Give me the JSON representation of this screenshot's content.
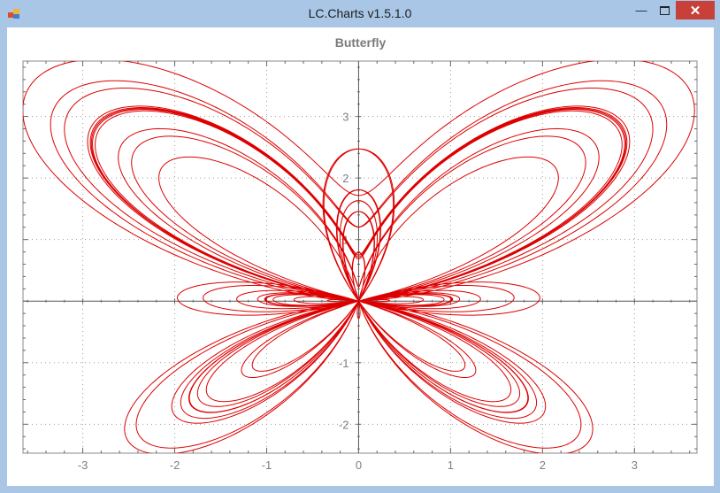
{
  "window": {
    "title": "LC.Charts v1.5.1.0",
    "min_icon": "minimize-icon",
    "max_icon": "maximize-icon",
    "close_icon": "close-icon"
  },
  "chart_data": {
    "type": "line",
    "title": "Butterfly",
    "xlabel": "",
    "ylabel": "",
    "xlim": [
      -3.65,
      3.68
    ],
    "ylim": [
      -2.47,
      3.9
    ],
    "x_ticks": [
      -3,
      -2,
      -1,
      0,
      1,
      2,
      3
    ],
    "y_ticks": [
      -2,
      -1,
      1,
      2,
      3
    ],
    "grid": true,
    "line_color": "#dd0000",
    "series": [
      {
        "equation": "r = e^(sin t) - 2cos(4t) + sin^5((2t - pi)/24)",
        "t_range": [
          0,
          75.4
        ]
      }
    ]
  }
}
